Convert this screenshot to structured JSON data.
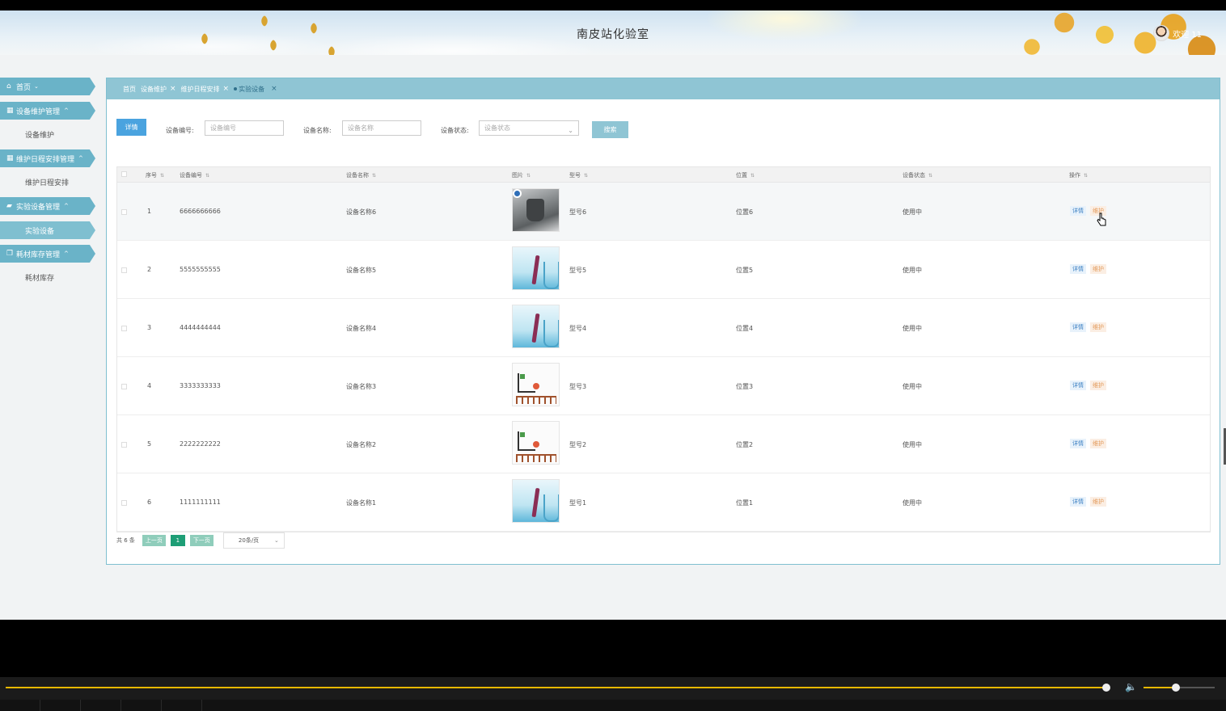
{
  "header": {
    "title": "南皮站化验室",
    "welcome": "欢迎 11"
  },
  "sidebar": {
    "home": "首页",
    "groups": [
      {
        "label": "设备维护管理",
        "items": [
          "设备维护"
        ]
      },
      {
        "label": "维护日程安排管理",
        "items": [
          "维护日程安排"
        ]
      },
      {
        "label": "实验设备管理",
        "items": [
          "实验设备"
        ]
      },
      {
        "label": "耗材库存管理",
        "items": [
          "耗材库存"
        ]
      }
    ]
  },
  "tabs": [
    {
      "label": "首页",
      "closable": false
    },
    {
      "label": "设备维护",
      "closable": true
    },
    {
      "label": "维护日程安排",
      "closable": true
    },
    {
      "label": "实验设备",
      "closable": true,
      "active": true
    }
  ],
  "toolbar": {
    "detail_label": "详情",
    "code_label": "设备编号:",
    "code_placeholder": "设备编号",
    "name_label": "设备名称:",
    "name_placeholder": "设备名称",
    "status_label": "设备状态:",
    "status_placeholder": "设备状态",
    "search_label": "搜索"
  },
  "table": {
    "columns": [
      "序号",
      "设备编号",
      "设备名称",
      "图片",
      "型号",
      "位置",
      "设备状态",
      "操作"
    ],
    "rows": [
      {
        "idx": "1",
        "code": "6666666666",
        "name": "设备名称6",
        "image": "machine",
        "model": "型号6",
        "location": "位置6",
        "status": "使用中"
      },
      {
        "idx": "2",
        "code": "5555555555",
        "name": "设备名称5",
        "image": "flask",
        "model": "型号5",
        "location": "位置5",
        "status": "使用中"
      },
      {
        "idx": "3",
        "code": "4444444444",
        "name": "设备名称4",
        "image": "flask",
        "model": "型号4",
        "location": "位置4",
        "status": "使用中"
      },
      {
        "idx": "4",
        "code": "3333333333",
        "name": "设备名称3",
        "image": "lab-set",
        "model": "型号3",
        "location": "位置3",
        "status": "使用中"
      },
      {
        "idx": "5",
        "code": "2222222222",
        "name": "设备名称2",
        "image": "lab-set",
        "model": "型号2",
        "location": "位置2",
        "status": "使用中"
      },
      {
        "idx": "6",
        "code": "1111111111",
        "name": "设备名称1",
        "image": "flask",
        "model": "型号1",
        "location": "位置1",
        "status": "使用中"
      }
    ],
    "row_actions": {
      "detail": "详情",
      "maintain": "维护"
    }
  },
  "pager": {
    "total": "共 6 条",
    "prev": "上一页",
    "current": "1",
    "next": "下一页",
    "page_size": "20条/页"
  },
  "player": {
    "progress": 0.997,
    "volume": 0.45
  },
  "colors": {
    "accent": "#8fc5d4",
    "primary_button": "#4aa3df",
    "pager_current": "#1e9e76",
    "progress": "#e7b800"
  }
}
